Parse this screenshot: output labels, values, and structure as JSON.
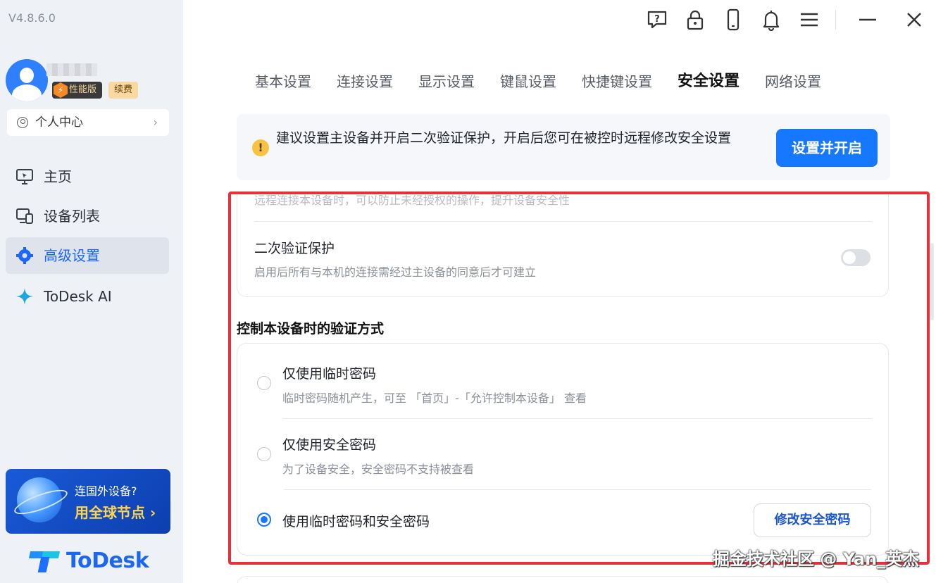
{
  "app": {
    "version": "V4.8.6.0",
    "logo_text": "ToDesk"
  },
  "user": {
    "badge_perf": "性能版",
    "badge_renew": "续费",
    "personal_center": "个人中心"
  },
  "sidebar": {
    "items": [
      {
        "label": "主页",
        "icon": "monitor-icon",
        "active": false
      },
      {
        "label": "设备列表",
        "icon": "devices-icon",
        "active": false
      },
      {
        "label": "高级设置",
        "icon": "gear-icon",
        "active": true
      },
      {
        "label": "ToDesk AI",
        "icon": "sparkle-icon",
        "active": false
      }
    ],
    "promo": {
      "line1": "连国外设备?",
      "line2": "用全球节点 ›"
    }
  },
  "topbar": {
    "icons": [
      "help-icon",
      "lock-icon",
      "phone-icon",
      "bell-icon",
      "menu-icon",
      "minimize-icon",
      "close-icon"
    ]
  },
  "tabs": [
    {
      "label": "基本设置",
      "active": false
    },
    {
      "label": "连接设置",
      "active": false
    },
    {
      "label": "显示设置",
      "active": false
    },
    {
      "label": "键鼠设置",
      "active": false
    },
    {
      "label": "快捷键设置",
      "active": false
    },
    {
      "label": "安全设置",
      "active": true
    },
    {
      "label": "网络设置",
      "active": false
    }
  ],
  "banner": {
    "text": "建议设置主设备并开启二次验证保护，开启后您可在被控时远程修改安全设置",
    "button": "设置并开启"
  },
  "security": {
    "faded_text": "远程连接本设备时，可以防止未经授权的操作，提升设备安全性",
    "two_factor": {
      "title": "二次验证保护",
      "desc": "启用后所有与本机的连接需经过主设备的同意后才可建立",
      "enabled": false
    },
    "auth_section_title": "控制本设备时的验证方式",
    "options": [
      {
        "title": "仅使用临时密码",
        "desc": "临时密码随机产生，可至 「首页」-「允许控制本设备」 查看",
        "checked": false
      },
      {
        "title": "仅使用安全密码",
        "desc": "为了设备安全，安全密码不支持被查看",
        "checked": false
      },
      {
        "title": "使用临时密码和安全密码",
        "desc": "",
        "checked": true
      }
    ],
    "modify_button": "修改安全密码"
  },
  "watermark": "掘金技术社区 @ Yan_英杰",
  "colors": {
    "accent": "#1677ff",
    "highlight_border": "#e8303a",
    "warning": "#f6c344"
  }
}
